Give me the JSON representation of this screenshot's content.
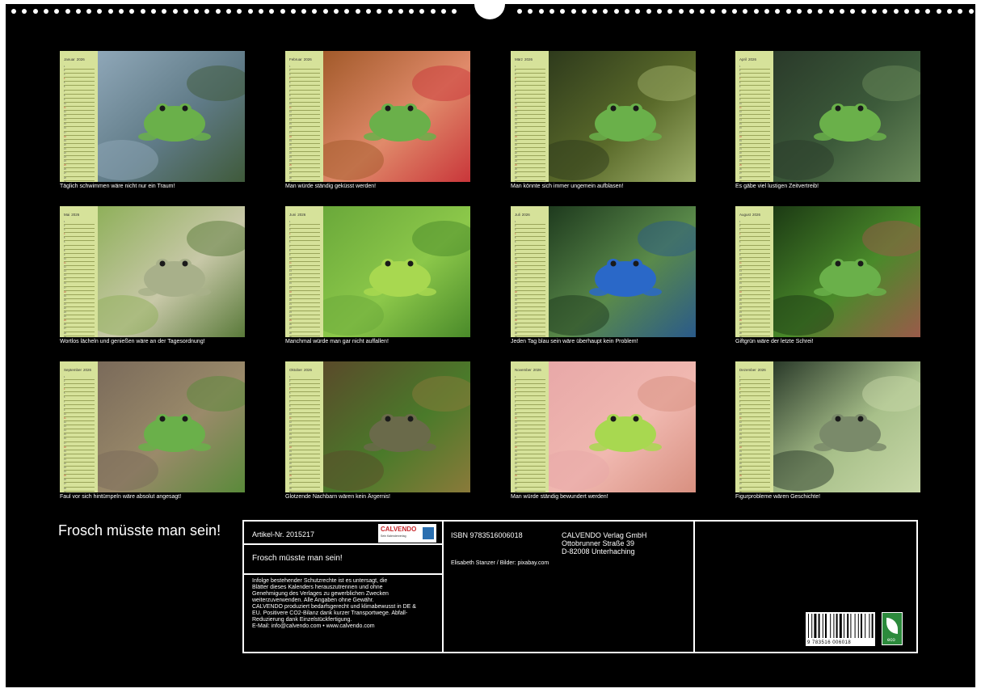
{
  "months": [
    {
      "name": "Januar",
      "year": "2026",
      "caption": "Täglich schwimmen wäre nicht nur ein Traum!",
      "photo": "frog-swimming-in-pond"
    },
    {
      "name": "Februar",
      "year": "2026",
      "caption": "Man würde ständig geküsst werden!",
      "photo": "frog-on-hand-with-lips"
    },
    {
      "name": "März",
      "year": "2026",
      "caption": "Man könnte sich immer ungemein aufblasen!",
      "photo": "frog-with-vocal-sacs"
    },
    {
      "name": "April",
      "year": "2026",
      "caption": "Es gäbe viel lustigen Zeitvertreib!",
      "photo": "frogs-on-lily-pads"
    },
    {
      "name": "Mai",
      "year": "2026",
      "caption": "Wortlos lächeln und genießen wäre an der Tagesordnung!",
      "photo": "whites-tree-frog"
    },
    {
      "name": "Juni",
      "year": "2026",
      "caption": "Manchmal würde man gar nicht auffallen!",
      "photo": "frog-on-green-leaf"
    },
    {
      "name": "Juli",
      "year": "2026",
      "caption": "Jeden Tag blau sein wäre überhaupt kein Problem!",
      "photo": "blue-poison-dart-frog"
    },
    {
      "name": "August",
      "year": "2026",
      "caption": "Giftgrün wäre der letzte Schrei!",
      "photo": "green-tree-frog-on-branch"
    },
    {
      "name": "September",
      "year": "2026",
      "caption": "Faul vor sich hintümpeln wäre absolut angesagt!",
      "photo": "frogs-in-shallow-water"
    },
    {
      "name": "Oktober",
      "year": "2026",
      "caption": "Glotzende Nachbarn wären kein Ärgernis!",
      "photo": "frogs-on-mossy-rock"
    },
    {
      "name": "November",
      "year": "2026",
      "caption": "Man würde ständig bewundert werden!",
      "photo": "tree-frog-on-finger"
    },
    {
      "name": "Dezember",
      "year": "2026",
      "caption": "Figurprobleme wären Geschichte!",
      "photo": "frog-on-lily-pad"
    }
  ],
  "title": "Frosch müsste man sein!",
  "info": {
    "article": "Artikel-Nr. 2015217",
    "subtitle": "Frosch müsste man sein!",
    "logo_text": "CALVENDO",
    "logo_sub": "Sein Kalenderverlag",
    "legal": [
      "Infolge bestehender Schutzrechte ist es untersagt, die",
      "Blätter dieses Kalenders herauszutrennen und ohne",
      "Genehmigung des Verlages zu gewerblichen Zwecken",
      "weiterzuverwenden. Alle Angaben ohne Gewähr.",
      "CALVENDO produziert bedarfsgerecht und klimabewusst in DE &",
      "EU. Positivere CO2-Bilanz dank kurzer Transportwege. Abfall-",
      "Reduzierung dank Einzelstückfertigung.",
      "E-Mail: info@calvendo.com • www.calvendo.com"
    ],
    "isbn": "ISBN 9783516006018",
    "publisher": [
      "CALVENDO Verlag GmbH",
      "Ottobrunner Straße 39",
      "D-82008 Unterhaching"
    ],
    "credits": "Elisabeth Stanzer / Bilder: pixabay.com",
    "barcode_number": "9 783516 006018",
    "eco_label": "eco"
  },
  "colors": {
    "background": "#000000",
    "calendar_strip": "#d6e29a",
    "text": "#ffffff"
  }
}
